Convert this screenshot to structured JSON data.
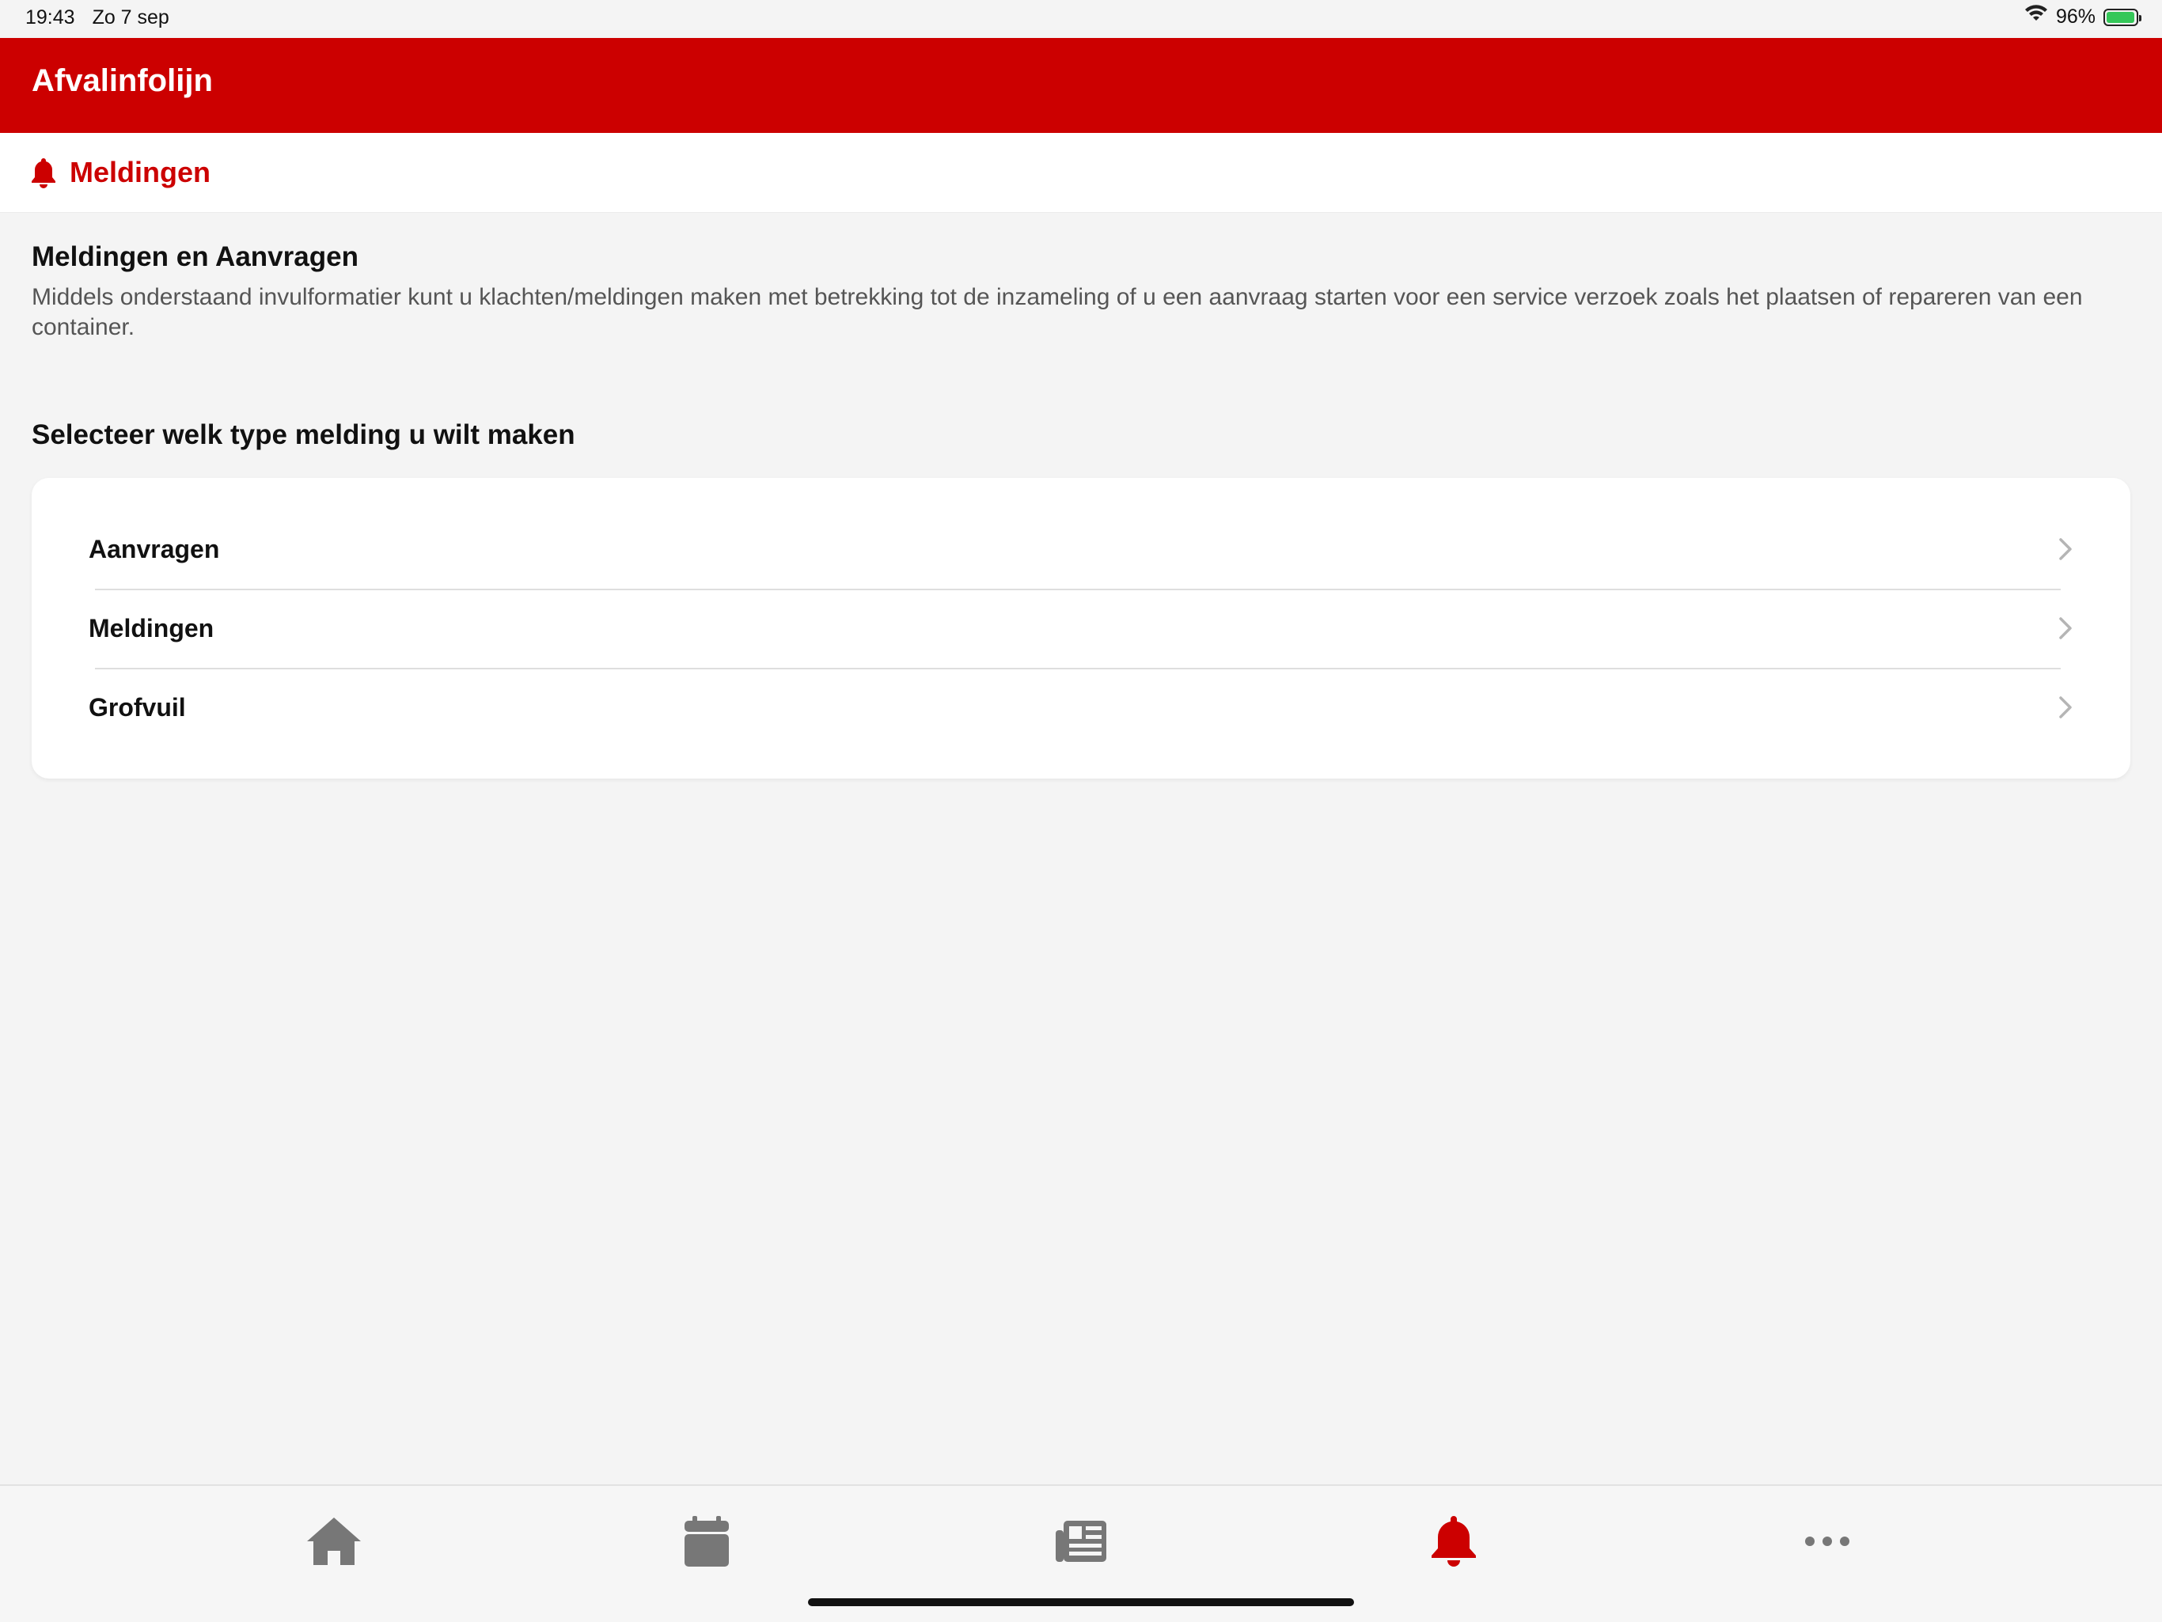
{
  "status_bar": {
    "time": "19:43",
    "date": "Zo 7 sep",
    "battery_percent": "96%",
    "battery_level": 0.96,
    "icons": [
      "wifi-icon",
      "battery-charging-icon"
    ]
  },
  "app_bar": {
    "title": "Afvalinfolijn",
    "background_color": "#cc0000"
  },
  "section": {
    "icon": "bell-icon",
    "label": "Meldingen"
  },
  "intro": {
    "heading": "Meldingen en Aanvragen",
    "description": "Middels onderstaand invulformatier kunt u klachten/meldingen maken met betrekking tot de inzameling of u een aanvraag starten voor een service verzoek zoals het plaatsen of repareren van een container."
  },
  "select_title": "Selecteer welk type melding u wilt maken",
  "options": [
    {
      "label": "Aanvragen",
      "icon": "chevron-right-icon"
    },
    {
      "label": "Meldingen",
      "icon": "chevron-right-icon"
    },
    {
      "label": "Grofvuil",
      "icon": "chevron-right-icon"
    }
  ],
  "tab_bar": {
    "active_color": "#cc0000",
    "inactive_color": "#777777",
    "tabs": [
      {
        "icon": "home-icon",
        "active": false
      },
      {
        "icon": "calendar-icon",
        "active": false
      },
      {
        "icon": "newspaper-icon",
        "active": false
      },
      {
        "icon": "bell-icon",
        "active": true
      },
      {
        "icon": "more-icon",
        "active": false
      }
    ]
  }
}
